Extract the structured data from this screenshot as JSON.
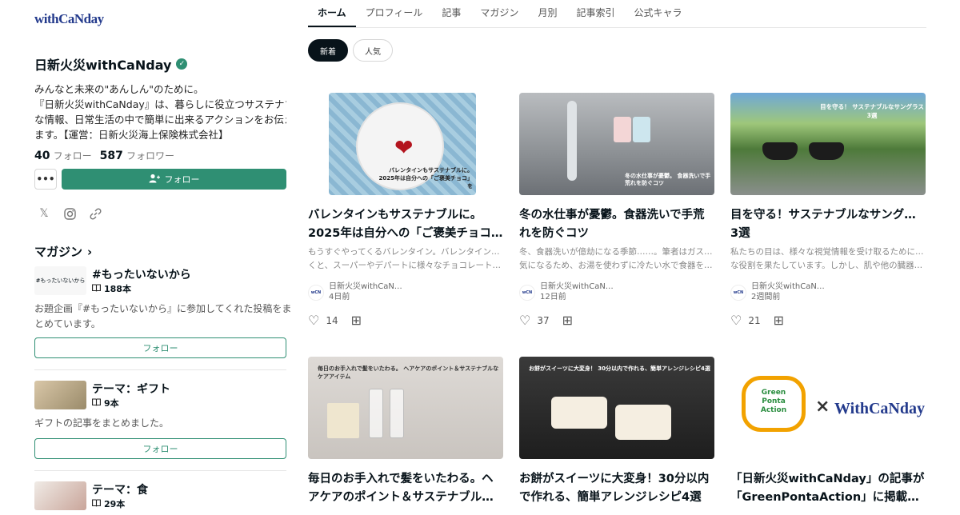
{
  "sidebar": {
    "logo": "withCaNday",
    "account_name": "日新火災withCaNday",
    "bio_lines": [
      "みんなと未来の\"あんしん\"のために。",
      "『日新火災withCaNday』は、暮らしに役立つサステナブル",
      "な情報、日常生活の中で簡単に出来るアクションをお伝えし",
      "ます。【運営：日新火災海上保険株式会社】"
    ],
    "following_count": "40",
    "following_label": "フォロー",
    "followers_count": "587",
    "followers_label": "フォロワー",
    "more_label": "•••",
    "follow_label": "フォロー",
    "magazine_heading": "マガジン",
    "magazines": [
      {
        "title": "#もったいないから",
        "count": "188本",
        "thumb": "#もったいないから",
        "desc_lines": [
          "お題企画『#もったいないから』に参加してくれた投稿をま",
          "とめています。"
        ],
        "follow": "フォロー"
      },
      {
        "title": "テーマ：ギフト",
        "count": "9本",
        "thumb": "",
        "desc_lines": [
          "ギフトの記事をまとめました。"
        ],
        "follow": "フォロー"
      },
      {
        "title": "テーマ：食",
        "count": "29本",
        "thumb": "",
        "desc_lines": [],
        "follow": ""
      }
    ]
  },
  "nav": {
    "tabs": [
      "ホーム",
      "プロフィール",
      "記事",
      "マガジン",
      "月別",
      "記事索引",
      "公式キャラ"
    ],
    "active": 0
  },
  "chips": [
    "新着",
    "人気"
  ],
  "cards": [
    {
      "title_lines": [
        "バレンタインもサステナブルに。",
        "2025年は自分への「ご褒美チョコ…"
      ],
      "excerpt_lines": [
        "もうすぐやってくるバレンタイン。バレンタインが近づ",
        "くと、スーパーやデパートに様々なチョコレートが並…"
      ],
      "author": "日新火災withCaN…",
      "date": "4日前",
      "likes": "14",
      "thumb_caption": "バレンタインもサステナブルに。 2025年は自分への「ご褒美チョコ」を"
    },
    {
      "title_lines": [
        "冬の水仕事が憂鬱。食器洗いで手荒",
        "れを防ぐコツ"
      ],
      "excerpt_lines": [
        "冬、食器洗いが億劫になる季節……。筆者はガス代が",
        "気になるため、お湯を使わずに冷たい水で食器を洗い…"
      ],
      "author": "日新火災withCaN…",
      "date": "12日前",
      "likes": "37",
      "thumb_caption": "冬の水仕事が憂鬱。 食器洗いで手荒れを防ぐコツ"
    },
    {
      "title_lines": [
        "目を守る！サステナブルなサングラス",
        "3選"
      ],
      "excerpt_lines": [
        "私たちの目は、様々な視覚情報を受け取るために重要",
        "な役割を果たしています。しかし、肌や他の臓器とは…"
      ],
      "author": "日新火災withCaN…",
      "date": "2週間前",
      "likes": "21",
      "thumb_caption": "目を守る！ サステナブルなサングラス3選"
    },
    {
      "title_lines": [
        "毎日のお手入れで髪をいたわる。ヘ",
        "アケアのポイント＆サステナブルな…"
      ],
      "thumb_caption": "毎日のお手入れで髪をいたわる。 ヘアケアのポイント＆サステナブルなケアアイテム"
    },
    {
      "title_lines": [
        "お餅がスイーツに大変身！30分以内",
        "で作れる、簡単アレンジレシピ4選"
      ],
      "thumb_caption": "お餅がスイーツに大変身！ 30分以内で作れる、簡単アレンジレシピ4選"
    },
    {
      "title_lines": [
        "「日新火災withCaNday」の記事が",
        "「GreenPontaAction」に掲載され…"
      ],
      "thumb_caption": "Green Ponta Action",
      "thumb_logo": "WithCaNday",
      "thumb_x": "×"
    }
  ],
  "colors": {
    "accent": "#2f8f73",
    "text": "#08131a",
    "logo": "#233a8c"
  },
  "icons": [
    "verified-icon",
    "add-user-icon",
    "x-icon",
    "instagram-icon",
    "link-icon",
    "chevron-right-icon",
    "book-icon",
    "heart-icon",
    "magazine-add-icon"
  ]
}
